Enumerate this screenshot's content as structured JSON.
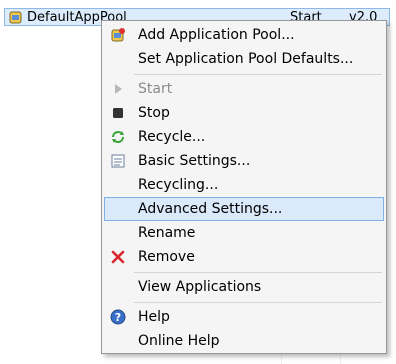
{
  "pool": {
    "name": "DefaultAppPool",
    "status": "Start",
    "version": "v2.0"
  },
  "menu": {
    "add": "Add Application Pool...",
    "set_defaults": "Set Application Pool Defaults...",
    "start": "Start",
    "stop": "Stop",
    "recycle": "Recycle...",
    "basic_settings": "Basic Settings...",
    "recycling": "Recycling...",
    "advanced_settings": "Advanced Settings...",
    "rename": "Rename",
    "remove": "Remove",
    "view_applications": "View Applications",
    "help": "Help",
    "online_help": "Online Help"
  },
  "colors": {
    "accent_hover": "#dbeafb",
    "remove_red": "#d9272e",
    "help_blue": "#3a6fc9"
  },
  "icons": [
    "app-pool-icon",
    "add-pool-icon",
    "play-icon",
    "stop-icon",
    "recycle-icon",
    "settings-icon",
    "remove-x-icon",
    "help-icon"
  ]
}
